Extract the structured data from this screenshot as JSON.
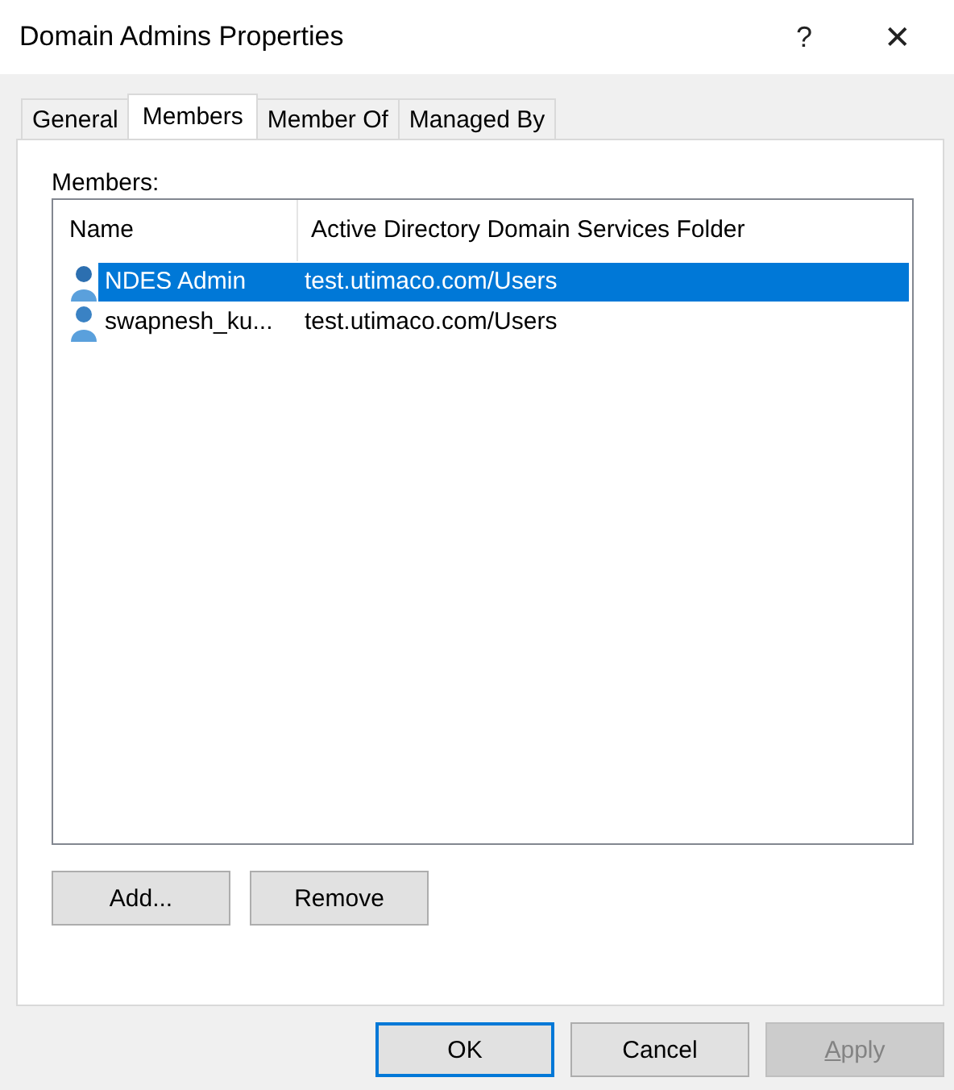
{
  "window": {
    "title": "Domain Admins Properties",
    "help": "?",
    "close": "✕"
  },
  "tabs": [
    {
      "label": "General",
      "selected": false
    },
    {
      "label": "Members",
      "selected": true
    },
    {
      "label": "Member Of",
      "selected": false
    },
    {
      "label": "Managed By",
      "selected": false
    }
  ],
  "members_label": "Members:",
  "table": {
    "columns": [
      "Name",
      "Active Directory Domain Services Folder"
    ],
    "rows": [
      {
        "cells": [
          "NDES Admin",
          "test.utimaco.com/Users"
        ],
        "selected": true
      },
      {
        "cells": [
          "swapnesh_ku...",
          "test.utimaco.com/Users"
        ],
        "selected": false
      }
    ]
  },
  "list_buttons": [
    {
      "label": "Add...",
      "disabled": false
    },
    {
      "label": "Remove",
      "disabled": false
    }
  ],
  "dialog_buttons": [
    {
      "label": "OK",
      "disabled": false,
      "default": true
    },
    {
      "label": "Cancel",
      "disabled": false,
      "default": false
    },
    {
      "label": "Apply",
      "disabled": true,
      "default": false
    }
  ]
}
